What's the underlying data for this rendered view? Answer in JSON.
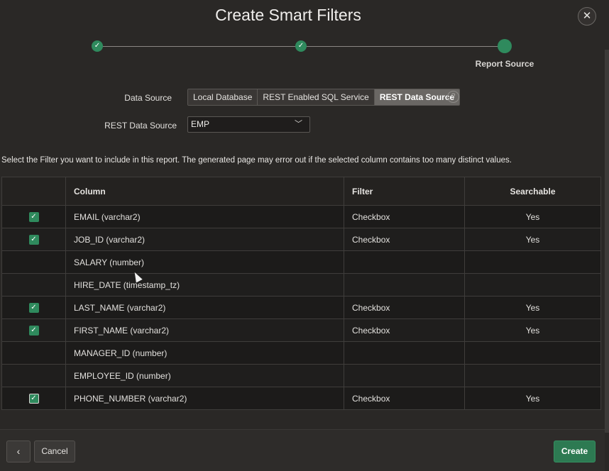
{
  "dialog": {
    "title": "Create Smart Filters",
    "close_symbol": "✕"
  },
  "wizard": {
    "current_step_label": "Report Source"
  },
  "form": {
    "data_source_label": "Data Source",
    "data_source_options": [
      "Local Database",
      "REST Enabled SQL Service",
      "REST Data Source"
    ],
    "data_source_selected": "REST Data Source",
    "rest_data_source_label": "REST Data Source",
    "rest_data_source_value": "EMP"
  },
  "instructions": "Select the Filter you want to include in this report. The generated page may error out if the selected column contains too many distinct values.",
  "table": {
    "headers": {
      "select": "",
      "column": "Column",
      "filter": "Filter",
      "searchable": "Searchable"
    },
    "rows": [
      {
        "selected": true,
        "column": "EMAIL (varchar2)",
        "filter": "Checkbox",
        "searchable": "Yes"
      },
      {
        "selected": true,
        "column": "JOB_ID (varchar2)",
        "filter": "Checkbox",
        "searchable": "Yes"
      },
      {
        "selected": false,
        "column": "SALARY (number)",
        "filter": "",
        "searchable": ""
      },
      {
        "selected": false,
        "column": "HIRE_DATE (timestamp_tz)",
        "filter": "",
        "searchable": ""
      },
      {
        "selected": true,
        "column": "LAST_NAME (varchar2)",
        "filter": "Checkbox",
        "searchable": "Yes"
      },
      {
        "selected": true,
        "column": "FIRST_NAME (varchar2)",
        "filter": "Checkbox",
        "searchable": "Yes"
      },
      {
        "selected": false,
        "column": "MANAGER_ID (number)",
        "filter": "",
        "searchable": ""
      },
      {
        "selected": false,
        "column": "EMPLOYEE_ID (number)",
        "filter": "",
        "searchable": ""
      },
      {
        "selected": true,
        "column": "PHONE_NUMBER (varchar2)",
        "filter": "Checkbox",
        "searchable": "Yes"
      }
    ]
  },
  "footer": {
    "back_symbol": "‹",
    "cancel_label": "Cancel",
    "create_label": "Create"
  },
  "colors": {
    "accent": "#2f8a5d",
    "background": "#2a2826",
    "table_bg": "#1c1b1a"
  }
}
